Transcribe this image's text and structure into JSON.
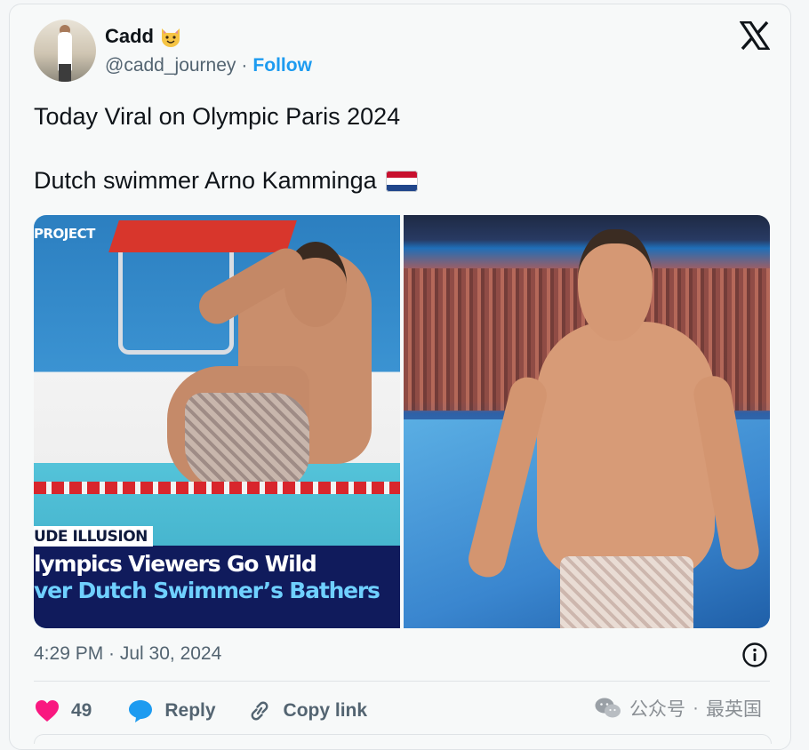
{
  "tweet": {
    "author": {
      "display_name": "Cadd",
      "emoji": "😺",
      "handle": "@cadd_journey",
      "separator": "·",
      "follow_label": "Follow"
    },
    "text_line_1": "Today Viral on Olympic Paris 2024",
    "text_line_2": "Dutch swimmer Arno Kamminga",
    "flag_icon": "netherlands-flag-icon",
    "media": {
      "left_overlay_project": "PROJECT",
      "left_overlay_tag": "UDE ILLUSION",
      "left_overlay_line_1": "lympics Viewers Go Wild",
      "left_overlay_line_2": "ver Dutch Swimmer’s Bathers"
    },
    "timestamp": "4:29 PM · Jul 30, 2024",
    "actions": {
      "like_count": "49",
      "reply_label": "Reply",
      "copy_link_label": "Copy link"
    }
  },
  "watermark": {
    "text_1": "公众号",
    "separator": "·",
    "text_2": "最英国"
  },
  "colors": {
    "follow_blue": "#1d9bf0",
    "like_pink": "#f91880",
    "reply_blue": "#1d9bf0",
    "text_primary": "#0f1419",
    "text_secondary": "#536471"
  },
  "icons": [
    "x-logo-icon",
    "info-icon",
    "heart-icon",
    "reply-bubble-icon",
    "link-icon",
    "wechat-icon",
    "netherlands-flag-icon"
  ]
}
